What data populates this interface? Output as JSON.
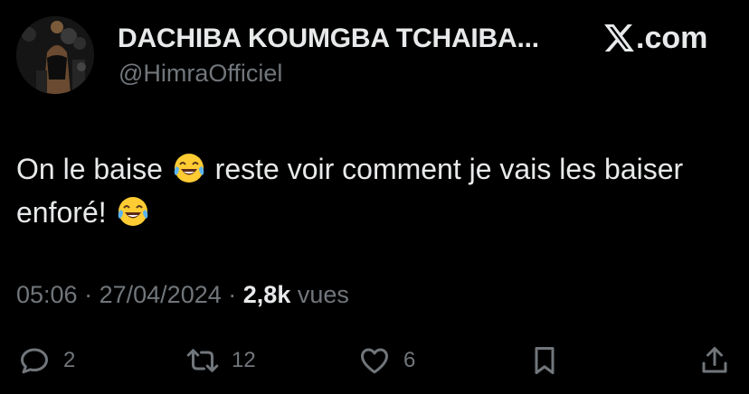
{
  "author": {
    "display_name": "DACHIBA KOUMGBA TCHAIBA...",
    "handle": "@HimraOfficiel"
  },
  "brand": {
    "label": ".com"
  },
  "tweet": {
    "text_part1": "On le baise",
    "text_part2": " reste voir comment je vais les baiser enforé!",
    "emoji": "face-with-tears-of-joy"
  },
  "meta": {
    "time": "05:06",
    "separator": "·",
    "date": "27/04/2024",
    "view_count": "2,8k",
    "view_label": "vues"
  },
  "actions": {
    "replies": "2",
    "reposts": "12",
    "likes": "6"
  },
  "colors": {
    "background": "#000000",
    "text": "#e7e9ea",
    "secondary": "#71767b"
  }
}
